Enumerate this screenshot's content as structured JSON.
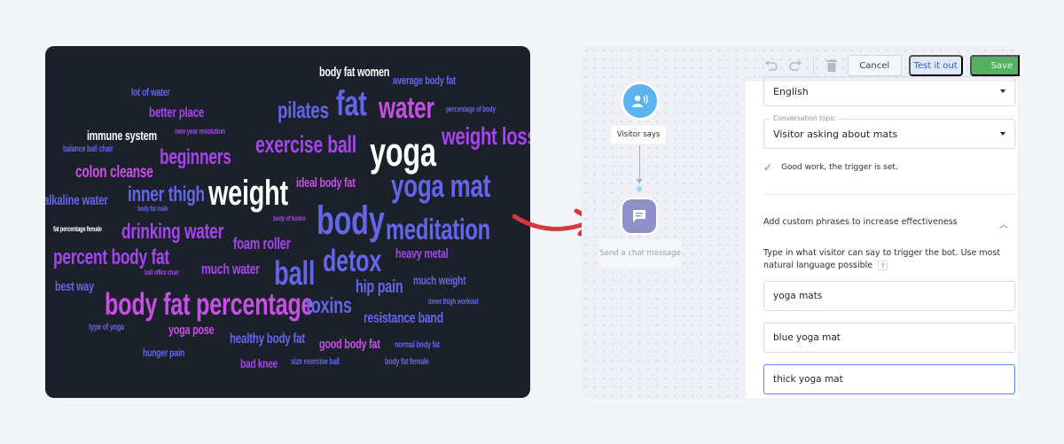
{
  "word_cloud": {
    "words": [
      {
        "text": "body fat women",
        "color": "white",
        "size": 15
      },
      {
        "text": "average body fat",
        "color": "blue",
        "size": 13
      },
      {
        "text": "lot of water",
        "color": "blue",
        "size": 12
      },
      {
        "text": "pilates",
        "color": "blue",
        "size": 26
      },
      {
        "text": "fat",
        "color": "blue",
        "size": 40
      },
      {
        "text": "water",
        "color": "magenta",
        "size": 34
      },
      {
        "text": "percentage of body",
        "color": "blue",
        "size": 9
      },
      {
        "text": "better place",
        "color": "purple",
        "size": 16
      },
      {
        "text": "immune system",
        "color": "white",
        "size": 15
      },
      {
        "text": "new year resolution",
        "color": "purple",
        "size": 9
      },
      {
        "text": "exercise ball",
        "color": "purple",
        "size": 27
      },
      {
        "text": "yoga",
        "color": "white",
        "size": 45
      },
      {
        "text": "weight loss",
        "color": "purple",
        "size": 28
      },
      {
        "text": "balance ball chair",
        "color": "blue",
        "size": 10
      },
      {
        "text": "beginners",
        "color": "purple",
        "size": 24
      },
      {
        "text": "colon cleanse",
        "color": "magenta",
        "size": 19
      },
      {
        "text": "weight",
        "color": "white",
        "size": 40
      },
      {
        "text": "ideal body fat",
        "color": "magenta",
        "size": 15
      },
      {
        "text": "yoga mat",
        "color": "blue",
        "size": 36
      },
      {
        "text": "inner thigh",
        "color": "blue",
        "size": 24
      },
      {
        "text": "alkaline water",
        "color": "blue",
        "size": 16
      },
      {
        "text": "body fat male",
        "color": "blue",
        "size": 8
      },
      {
        "text": "body",
        "color": "blue",
        "size": 45
      },
      {
        "text": "body of toxins",
        "color": "purple",
        "size": 8
      },
      {
        "text": "meditation",
        "color": "blue",
        "size": 33
      },
      {
        "text": "fat percentage female",
        "color": "white",
        "size": 8
      },
      {
        "text": "drinking water",
        "color": "purple",
        "size": 24
      },
      {
        "text": "foam roller",
        "color": "purple",
        "size": 18
      },
      {
        "text": "heavy metal",
        "color": "purple",
        "size": 15
      },
      {
        "text": "detox",
        "color": "blue",
        "size": 35
      },
      {
        "text": "percent body fat",
        "color": "purple",
        "size": 24
      },
      {
        "text": "ball office chair",
        "color": "purple",
        "size": 8
      },
      {
        "text": "much water",
        "color": "purple",
        "size": 17
      },
      {
        "text": "ball",
        "color": "blue",
        "size": 38
      },
      {
        "text": "hip pain",
        "color": "blue",
        "size": 20
      },
      {
        "text": "much weight",
        "color": "blue",
        "size": 14
      },
      {
        "text": "best way",
        "color": "blue",
        "size": 15
      },
      {
        "text": "body fat percentage",
        "color": "magenta",
        "size": 35
      },
      {
        "text": "toxins",
        "color": "blue",
        "size": 25
      },
      {
        "text": "inner thigh workout",
        "color": "blue",
        "size": 9
      },
      {
        "text": "resistance band",
        "color": "blue",
        "size": 17
      },
      {
        "text": "type of yoga",
        "color": "blue",
        "size": 10
      },
      {
        "text": "yoga pose",
        "color": "magenta",
        "size": 15
      },
      {
        "text": "healthy body fat",
        "color": "blue",
        "size": 16
      },
      {
        "text": "good body fat",
        "color": "magenta",
        "size": 15
      },
      {
        "text": "normal body fat",
        "color": "blue",
        "size": 10
      },
      {
        "text": "hunger pain",
        "color": "blue",
        "size": 12
      },
      {
        "text": "bad knee",
        "color": "purple",
        "size": 14
      },
      {
        "text": "size exercise ball",
        "color": "blue",
        "size": 10
      },
      {
        "text": "body fat female",
        "color": "blue",
        "size": 10
      }
    ]
  },
  "toolbar": {
    "undo_icon": "undo-icon",
    "redo_icon": "redo-icon",
    "delete_icon": "trash-icon",
    "cancel_label": "Cancel",
    "test_label": "Test it out",
    "save_label": "Save"
  },
  "flow": {
    "trigger_node_label": "Visitor says",
    "trigger_icon": "visitor-speaking-icon",
    "action_node_label": "Send a chat message",
    "action_icon": "chat-message-icon"
  },
  "settings": {
    "language_value": "English",
    "topic_label": "Conversation topic",
    "topic_value": "Visitor asking about mats",
    "success_message": "Good work, the trigger is set.",
    "custom_phrases_heading": "Add custom phrases to increase effectiveness",
    "hint_text": "Type in what visitor can say to trigger the bot. Use most natural language possible",
    "help_glyph": "?",
    "phrases": [
      "yoga mats",
      "blue yoga mat",
      "thick yoga mat"
    ]
  }
}
